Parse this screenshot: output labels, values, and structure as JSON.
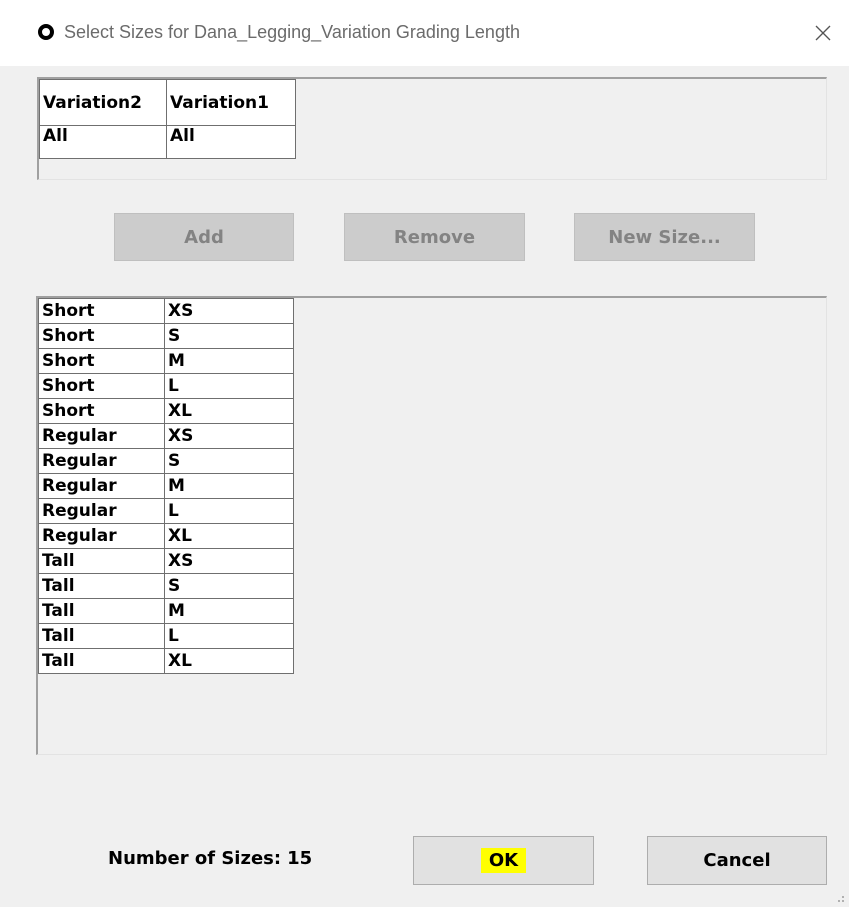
{
  "window": {
    "title": "Select Sizes for Dana_Legging_Variation Grading Length",
    "icon": "app-ring-icon",
    "close_icon": "close-icon"
  },
  "header_table": {
    "columns": [
      "Variation2",
      "Variation1"
    ],
    "row": [
      "All",
      "All"
    ]
  },
  "buttons": {
    "add": "Add",
    "remove": "Remove",
    "new_size": "New Size...",
    "ok": "OK",
    "cancel": "Cancel"
  },
  "sizes": [
    [
      "Short",
      "XS"
    ],
    [
      "Short",
      "S"
    ],
    [
      "Short",
      "M"
    ],
    [
      "Short",
      "L"
    ],
    [
      "Short",
      "XL"
    ],
    [
      "Regular",
      "XS"
    ],
    [
      "Regular",
      "S"
    ],
    [
      "Regular",
      "M"
    ],
    [
      "Regular",
      "L"
    ],
    [
      "Regular",
      "XL"
    ],
    [
      "Tall",
      "XS"
    ],
    [
      "Tall",
      "S"
    ],
    [
      "Tall",
      "M"
    ],
    [
      "Tall",
      "L"
    ],
    [
      "Tall",
      "XL"
    ]
  ],
  "footer": {
    "count_label": "Number of Sizes:",
    "count_value": "15"
  },
  "colors": {
    "ok_highlight": "#ffff00",
    "disabled_button": "#cccccc",
    "dialog_bg": "#f0f0f0"
  }
}
